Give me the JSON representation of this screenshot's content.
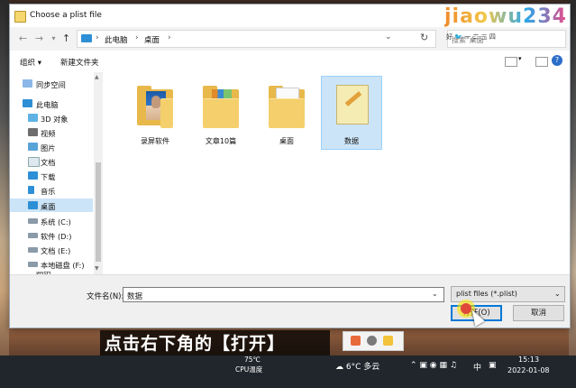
{
  "window": {
    "title": "Choose a plist file"
  },
  "address": {
    "crumbs": [
      "此电脑",
      "桌面"
    ],
    "search_placeholder": "搜索\"桌面\""
  },
  "toolbar": {
    "organize": "组织 ▾",
    "new_folder": "新建文件夹"
  },
  "sidebar": {
    "items": [
      {
        "label": "同步空间",
        "icon": "cloud-icon"
      },
      {
        "label": "此电脑",
        "icon": "computer-icon"
      },
      {
        "label": "3D 对象",
        "icon": "cube-icon"
      },
      {
        "label": "视频",
        "icon": "video-icon"
      },
      {
        "label": "图片",
        "icon": "picture-icon"
      },
      {
        "label": "文档",
        "icon": "document-icon"
      },
      {
        "label": "下载",
        "icon": "download-icon"
      },
      {
        "label": "音乐",
        "icon": "music-icon"
      },
      {
        "label": "桌面",
        "icon": "desktop-icon",
        "selected": true
      },
      {
        "label": "系统 (C:)",
        "icon": "drive-icon"
      },
      {
        "label": "软件 (D:)",
        "icon": "drive-icon"
      },
      {
        "label": "文档 (E:)",
        "icon": "drive-icon"
      },
      {
        "label": "本地磁盘 (F:)",
        "icon": "drive-icon"
      },
      {
        "label": "网络",
        "icon": "network-icon"
      }
    ]
  },
  "files": [
    {
      "label": "录屏软件",
      "type": "folder-photo"
    },
    {
      "label": "文章10篇",
      "type": "folder-doc"
    },
    {
      "label": "桌面",
      "type": "folder-paper"
    },
    {
      "label": "数据",
      "type": "plist-file",
      "selected": true
    }
  ],
  "bottom": {
    "filename_label": "文件名(N):",
    "filename_value": "数据",
    "filetype_value": "plist files (*.plist)",
    "open_label": "打开(O)",
    "cancel_label": "取消"
  },
  "watermark": {
    "text": "jiaowu234",
    "sub": "好 🐦 一 二 三 四"
  },
  "overlay": {
    "subtitle": "点击右下角的【打开】"
  },
  "taskbar": {
    "temp": "75℃",
    "cpu_label": "CPU温度",
    "weather": "6°C 多云",
    "ime": "中",
    "time": "15:13",
    "date": "2022-01-08"
  },
  "colors": {
    "accent": "#0078d7",
    "selection": "#cce4f7",
    "folder": "#e8b94a"
  }
}
